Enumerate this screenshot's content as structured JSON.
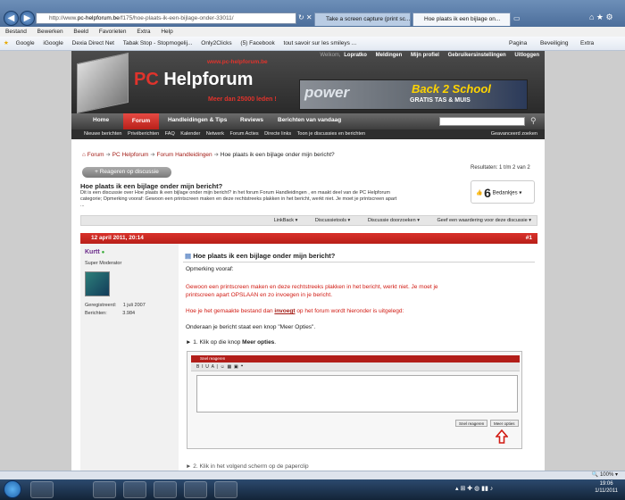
{
  "browser": {
    "back_icon": "back-arrow-icon",
    "forward_icon": "forward-arrow-icon",
    "address_prefix": "http://www.",
    "address_domain": "pc-helpforum.be",
    "address_rest": "/f175/hoe-plaats-ik-een-bijlage-onder-33011/",
    "tabs": [
      {
        "label": "Take a screen capture (print sc...",
        "active": false
      },
      {
        "label": "Hoe plaats ik een bijlage on...",
        "active": true
      }
    ],
    "menu": [
      "Bestand",
      "Bewerken",
      "Beeld",
      "Favorieten",
      "Extra",
      "Help"
    ],
    "favorites": [
      "Google",
      "iGoogle",
      "Dexia Direct Net",
      "Tabak Stop - Stopmogelij...",
      "Only2Clicks",
      "(5) Facebook",
      "tout savoir sur les smileys ..."
    ],
    "toolbar": [
      "Pagina",
      "Beveiliging",
      "Extra"
    ],
    "zoom": "100%"
  },
  "site": {
    "url_tag": "www.pc-helpforum.be",
    "title_pc": "PC",
    "title_rest": " Helpforum",
    "subtitle": "Meer dan 25000 leden !",
    "top_links": {
      "welcome": "Welkom,",
      "user": "Lopratko",
      "items": [
        "Meldingen",
        "Mijn profiel",
        "Gebruikersinstellingen",
        "Uitloggen"
      ]
    },
    "ad": {
      "brand": "power",
      "headline": "Back 2 School",
      "tagline": "GRATIS TAS & MUIS"
    },
    "nav": [
      "Home",
      "Forum",
      "Handleidingen & Tips",
      "Reviews",
      "Berichten van vandaag"
    ],
    "subnav": [
      "Nieuwe berichten",
      "Privéberichten",
      "FAQ",
      "Kalender",
      "Netwerk",
      "Forum Acties",
      "Directe links",
      "Toon je discussies en berichten"
    ],
    "advanced_search": "Geavanceerd zoeken"
  },
  "thread": {
    "breadcrumb": [
      "Forum",
      "PC Helpforum",
      "Forum Handleidingen",
      "Hoe plaats ik een bijlage onder mijn bericht?"
    ],
    "reply_label": "+ Reageren op discussie",
    "results": "Resultaten: 1 t/m 2 van 2",
    "title": "Hoe plaats ik een bijlage onder mijn bericht?",
    "description": "Dit is een discussie over Hoe plaats ik een bijlage onder mijn bericht? in het forum Forum Handleidingen , en maakt deel van de PC Helpforum categorie; Opmerking vooraf: Gewoon een printscreen maken en deze rechtstreeks plakken in het bericht, werkt niet. Je moet je printscreen apart ...",
    "likes_count": "6",
    "likes_label": "Bedankjes",
    "tools": [
      "LinkBack",
      "Discussietools",
      "Discussie doorzoeken",
      "Geef een waardering voor deze discussie"
    ]
  },
  "post": {
    "date": "12 april 2011, 20:14",
    "number": "#1",
    "author": "Kurtt",
    "role": "Super Moderator",
    "registered_label": "Geregistreerd:",
    "registered_value": "1 juli 2007",
    "posts_label": "Berichten:",
    "posts_value": "3.984",
    "title": "Hoe plaats ik een bijlage onder mijn bericht?",
    "line1": "Opmerking vooraf:",
    "line2a": "Gewoon een printscreen maken en deze rechtstreeks plakken in het bericht, werkt niet. Je moet je",
    "line2b": "printscreen apart OPSLAAN en zo invoegen in je bericht.",
    "line3_pre": "Hoe je het gemaakte bestand dan ",
    "line3_link": "invoegt",
    "line3_post": " op het forum wordt hieronder is uitgelegd:",
    "line4": "Onderaan je bericht staat een knop \"Meer Opties\".",
    "step1_pre": "► 1. Klik op die knop ",
    "step1_bold": "Meer opties",
    "step1_post": ".",
    "screenshot": {
      "header": "Snel reageren",
      "btn_save": "Snel reageren",
      "btn_more": "Meer opties"
    },
    "next_step": "► 2. Klik in het volgend scherm op de paperclip"
  },
  "taskbar": {
    "time": "19:06",
    "date": "1/11/2011"
  },
  "colors": {
    "accent": "#c4221c",
    "link": "#d11b13",
    "nav_bg": "#3d3d3d"
  }
}
